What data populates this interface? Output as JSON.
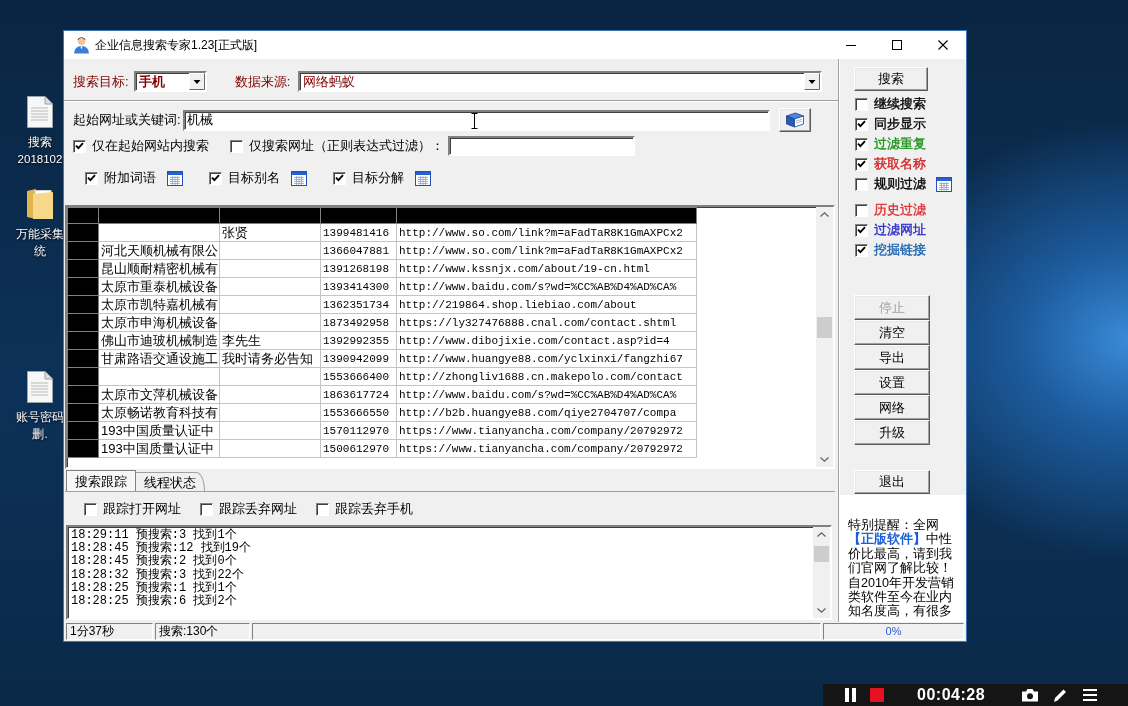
{
  "desktop_icons": [
    {
      "kind": "document",
      "lines": [
        "搜索",
        "2018102"
      ]
    },
    {
      "kind": "folder",
      "lines": [
        "万能采集",
        "统"
      ]
    },
    {
      "kind": "document",
      "lines": [
        "账号密码",
        "删."
      ]
    }
  ],
  "window": {
    "title": "企业信息搜索专家1.23[正式版]"
  },
  "search_target": {
    "label": "搜索目标:",
    "value": "手机"
  },
  "data_source": {
    "label": "数据来源:",
    "value": "网络蚂蚁"
  },
  "start_keyword": {
    "label": "起始网址或关键词:",
    "value": "机械"
  },
  "search_options": [
    {
      "kind": "plain",
      "label": "仅在起始网站内搜索",
      "checked": true
    },
    {
      "kind": "field",
      "label": "仅搜索网址（正则表达式过滤）：",
      "checked": false
    }
  ],
  "extras": [
    {
      "label": "附加词语",
      "checked": true
    },
    {
      "label": "目标别名",
      "checked": true
    },
    {
      "label": "目标分解",
      "checked": true
    }
  ],
  "table": {
    "rows": [
      {
        "column_3": "张贤",
        "column_4": "1399481416",
        "column_5": "http://www.so.com/link?m=aFadTaR8K1GmAXPCx2"
      },
      {
        "column_2": "河北天顺机械有限公",
        "column_4": "1366047881",
        "column_5": "http://www.so.com/link?m=aFadTaR8K1GmAXPCx2"
      },
      {
        "column_2": "昆山顺耐精密机械有",
        "column_4": "1391268198",
        "column_5": "http://www.kssnjx.com/about/19-cn.html"
      },
      {
        "column_2": "太原市重泰机械设备",
        "column_4": "1393414300",
        "column_5": "http://www.baidu.com/s?wd=%CC%AB%D4%AD%CA%"
      },
      {
        "column_2": "太原市凯特嘉机械有",
        "column_4": "1362351734",
        "column_5": "http://219864.shop.liebiao.com/about"
      },
      {
        "column_2": "太原市申海机械设备",
        "column_4": "1873492958",
        "column_5": "https://ly327476888.cnal.com/contact.shtml"
      },
      {
        "column_2": "佛山市迪玻机械制造",
        "column_3": "李先生",
        "column_4": "1392992355",
        "column_5": "http://www.dibojixie.com/contact.asp?id=4"
      },
      {
        "column_2": "甘肃路语交通设施工",
        "column_3": "我时请务必告知",
        "column_4": "1390942099",
        "column_5": "http://www.huangye88.com/yclxinxi/fangzhi67"
      },
      {
        "column_4": "1553666400",
        "column_5": "http://zhongliv1688.cn.makepolo.com/contact"
      },
      {
        "column_2": "太原市文萍机械设备",
        "column_4": "1863617724",
        "column_5": "http://www.baidu.com/s?wd=%CC%AB%D4%AD%CA%"
      },
      {
        "column_2": "太原畅诺教育科技有",
        "column_4": "1553666550",
        "column_5": "http://b2b.huangye88.com/qiye2704707/compa"
      },
      {
        "column_2": "193中国质量认证中",
        "column_4": "1570112970",
        "column_5": "https://www.tianyancha.com/company/20792972"
      },
      {
        "column_2": "193中国质量认证中",
        "column_4": "1500612970",
        "column_5": "https://www.tianyancha.com/company/20792972"
      }
    ]
  },
  "bottom_tabs": [
    {
      "label": "搜索跟踪",
      "selected": true
    },
    {
      "label": "线程状态",
      "selected": false
    }
  ],
  "trace_options": [
    {
      "label": "跟踪打开网址",
      "checked": false
    },
    {
      "label": "跟踪丢弃网址",
      "checked": false
    },
    {
      "label": "跟踪丢弃手机",
      "checked": false
    }
  ],
  "log": [
    "18:29:11 预搜索:3 找到1个",
    "18:28:45 预搜索:12 找到19个",
    "18:28:45 预搜索:2 找到0个",
    "18:28:32 预搜索:3 找到22个",
    "18:28:25 预搜索:1 找到1个",
    "18:28:25 预搜索:6 找到2个"
  ],
  "side_panel": {
    "search_button": "搜索",
    "toggle_groups": [
      {
        "toggles": [
          {
            "kind": "plain",
            "label": "继续搜索",
            "checked": false,
            "color": "#000000"
          },
          {
            "kind": "plain",
            "label": "同步显示",
            "checked": true,
            "color": "#000000"
          },
          {
            "kind": "plain",
            "label": "过滤重复",
            "checked": true,
            "color": "#1a941a"
          },
          {
            "kind": "plain",
            "label": "获取名称",
            "checked": true,
            "color": "#d02424"
          },
          {
            "kind": "iconed",
            "label": "规则过滤",
            "checked": false,
            "color": "#000000"
          }
        ]
      },
      {
        "toggles": [
          {
            "kind": "plain",
            "label": "历史过滤",
            "checked": false,
            "color": "#e03030"
          },
          {
            "kind": "plain",
            "label": "过滤网址",
            "checked": true,
            "color": "#2c2cc8"
          },
          {
            "kind": "plain",
            "label": "挖掘链接",
            "checked": true,
            "color": "#1c64b0"
          }
        ]
      }
    ],
    "buttons": [
      {
        "label": "停止",
        "disabled": true
      },
      {
        "label": "清空",
        "disabled": false
      },
      {
        "label": "导出",
        "disabled": false
      },
      {
        "label": "设置",
        "disabled": false
      },
      {
        "label": "网络",
        "disabled": false
      },
      {
        "label": "升级",
        "disabled": false
      }
    ],
    "exit_button": "退出",
    "notice": "特别提醒：全网**【正版软件】**中性价比最高，请到我们官网了解比较！自2010年开发营销类软件至今在业内知名度高，有很多"
  },
  "status_bar": {
    "elapsed": "1分37秒",
    "search_count": "搜索:130个",
    "progress": {
      "level": 0,
      "reading": "0%"
    }
  },
  "recorder": {
    "time": "00:04:28"
  }
}
